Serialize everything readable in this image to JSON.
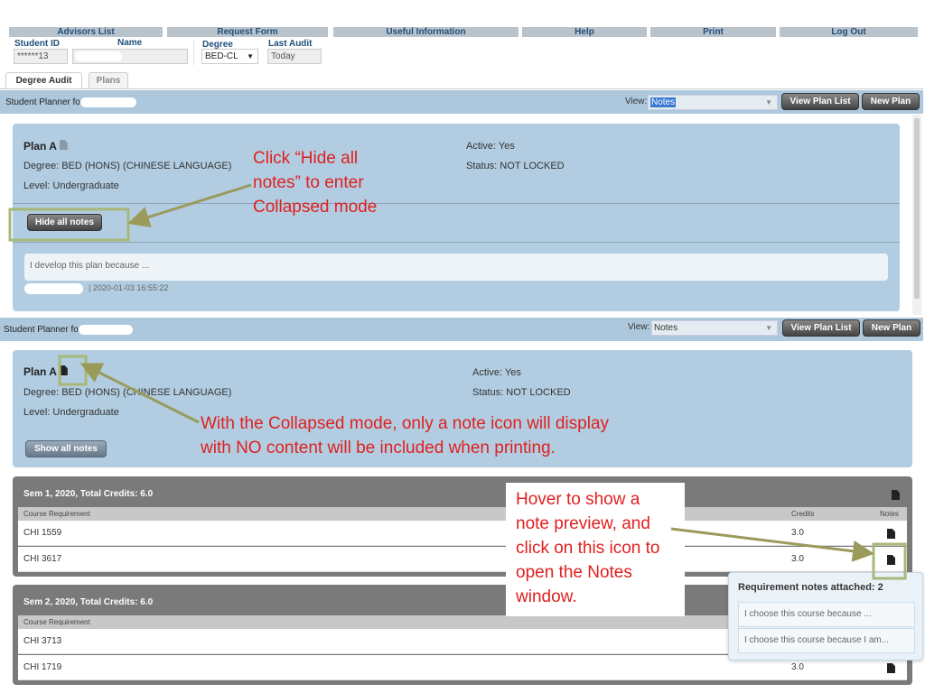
{
  "nav": [
    "Advisors List",
    "Request Form",
    "Useful Information",
    "Help",
    "Print",
    "Log Out"
  ],
  "fields": {
    "student_id_label": "Student ID",
    "student_id": "******13",
    "name_label": "Name",
    "degree_label": "Degree",
    "degree": "BED-CL",
    "last_audit_label": "Last Audit",
    "last_audit": "Today"
  },
  "tabs": [
    "Degree Audit",
    "Plans"
  ],
  "planner_label": "Student Planner for:",
  "view_label": "View:",
  "view_value": "Notes",
  "view_plan_list": "View Plan List",
  "new_plan": "New Plan",
  "plan": {
    "title": "Plan A",
    "degree": "Degree: BED (HONS) (CHINESE LANGUAGE)",
    "level": "Level: Undergraduate",
    "active": "Active: Yes",
    "status": "Status: NOT LOCKED",
    "hide_btn": "Hide all notes",
    "show_btn": "Show all notes",
    "note": "I develop this plan because ...",
    "note_time": "|   2020-01-03 16:55:22"
  },
  "annotations": {
    "a1": [
      "Click “Hide all",
      "notes” to enter",
      "Collapsed mode"
    ],
    "a2": [
      "With the Collapsed mode, only a note icon will display",
      "with NO content will be included when printing."
    ],
    "a3": [
      "Hover to show a",
      "note preview, and",
      "click on this icon to",
      "open the Notes",
      "window."
    ],
    "color": "#e02020",
    "arrow_color": "#9a9a5a"
  },
  "semesters": [
    {
      "title": "Sem 1, 2020, Total Credits: 6.0",
      "col_req": "Course Requirement",
      "col_credits": "Credits",
      "col_notes": "Notes",
      "rows": [
        {
          "course": "CHI 1559",
          "credits": "3.0"
        },
        {
          "course": "CHI 3617",
          "credits": "3.0"
        }
      ]
    },
    {
      "title": "Sem 2, 2020, Total Credits: 6.0",
      "col_req": "Course Requirement",
      "rows": [
        {
          "course": "CHI 3713",
          "credits": ""
        },
        {
          "course": "CHI 1719",
          "credits": "3.0"
        }
      ]
    }
  ],
  "popover": {
    "title": "Requirement notes attached: 2",
    "items": [
      "I choose this course because ...",
      "I choose this course because I am..."
    ]
  }
}
